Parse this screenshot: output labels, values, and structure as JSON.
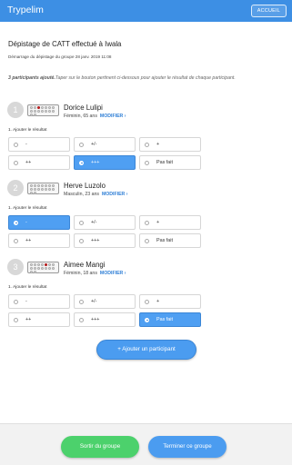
{
  "app": {
    "title": "Trypelim",
    "home_label": "ACCUEIL",
    "accent": "#3d8fe4"
  },
  "page": {
    "title": "Dépistage de CATT effectué à Iwala",
    "start_info": "Démarrage du dépistage du groupe 28 janv. 2019 11:08",
    "participants_count": "3 participants ajouté.",
    "instruction": "Taper sur le bouton pertinent ci-dessous pour ajouter le résultat de chaque participant."
  },
  "result_label": "1. Ajouter le résultat",
  "modify_label": "MODIFIER ›",
  "options": [
    "-",
    "+/-",
    "+",
    "++",
    "+++",
    "Pas fait"
  ],
  "participants": [
    {
      "number": "1",
      "name": "Dorice Lulipi",
      "info": "Féminin, 65 ans",
      "selected": "+++",
      "kit_red_dot": 2
    },
    {
      "number": "2",
      "name": "Herve Luzolo",
      "info": "Masculin, 23 ans",
      "selected": "-",
      "kit_red_dot": -1
    },
    {
      "number": "3",
      "name": "Aimee Mangi",
      "info": "Féminin, 18 ans",
      "selected": "Pas fait",
      "kit_red_dot": 4
    }
  ],
  "add_participant_label": "+ Ajouter un participant",
  "bottom": {
    "exit_label": "Sortir du groupe",
    "finish_label": "Terminer ce groupe"
  }
}
